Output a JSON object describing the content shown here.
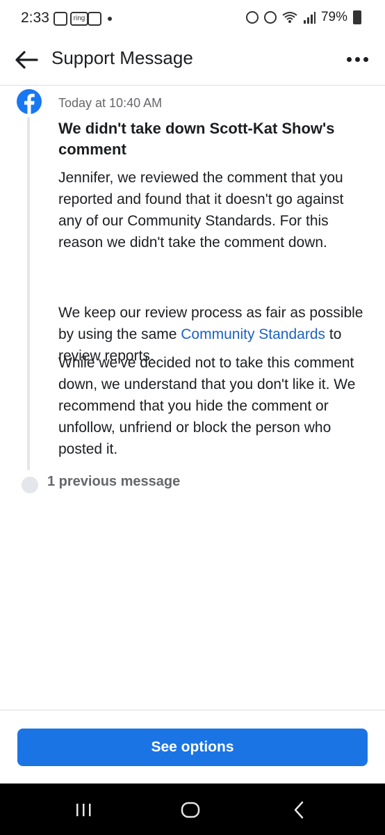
{
  "status_bar": {
    "time": "2:33",
    "ring_label": "ring",
    "battery": "79%"
  },
  "header": {
    "title": "Support Message"
  },
  "message": {
    "timestamp": "Today at 10:40 AM",
    "title": "We didn't take down Scott-Kat Show's comment",
    "paragraph1": "Jennifer, we reviewed the comment that you reported and found that it doesn't go against any of our Community Standards. For this reason we didn't take the comment down.",
    "paragraph2_before": "We keep our review process as fair as possible by using the same ",
    "paragraph2_link": "Community Standards",
    "paragraph2_after": " to review reports.",
    "paragraph3": "While we've decided not to take this comment down, we understand that you don't like it. We recommend that you hide the comment or unfollow, unfriend or block the person who posted it."
  },
  "thread": {
    "previous_label": "1 previous message"
  },
  "actions": {
    "see_options_label": "See options"
  },
  "colors": {
    "facebook_blue": "#1877f2",
    "link_blue": "#1b62c4",
    "button_blue": "#1b74e4",
    "secondary_text": "#65676b"
  }
}
